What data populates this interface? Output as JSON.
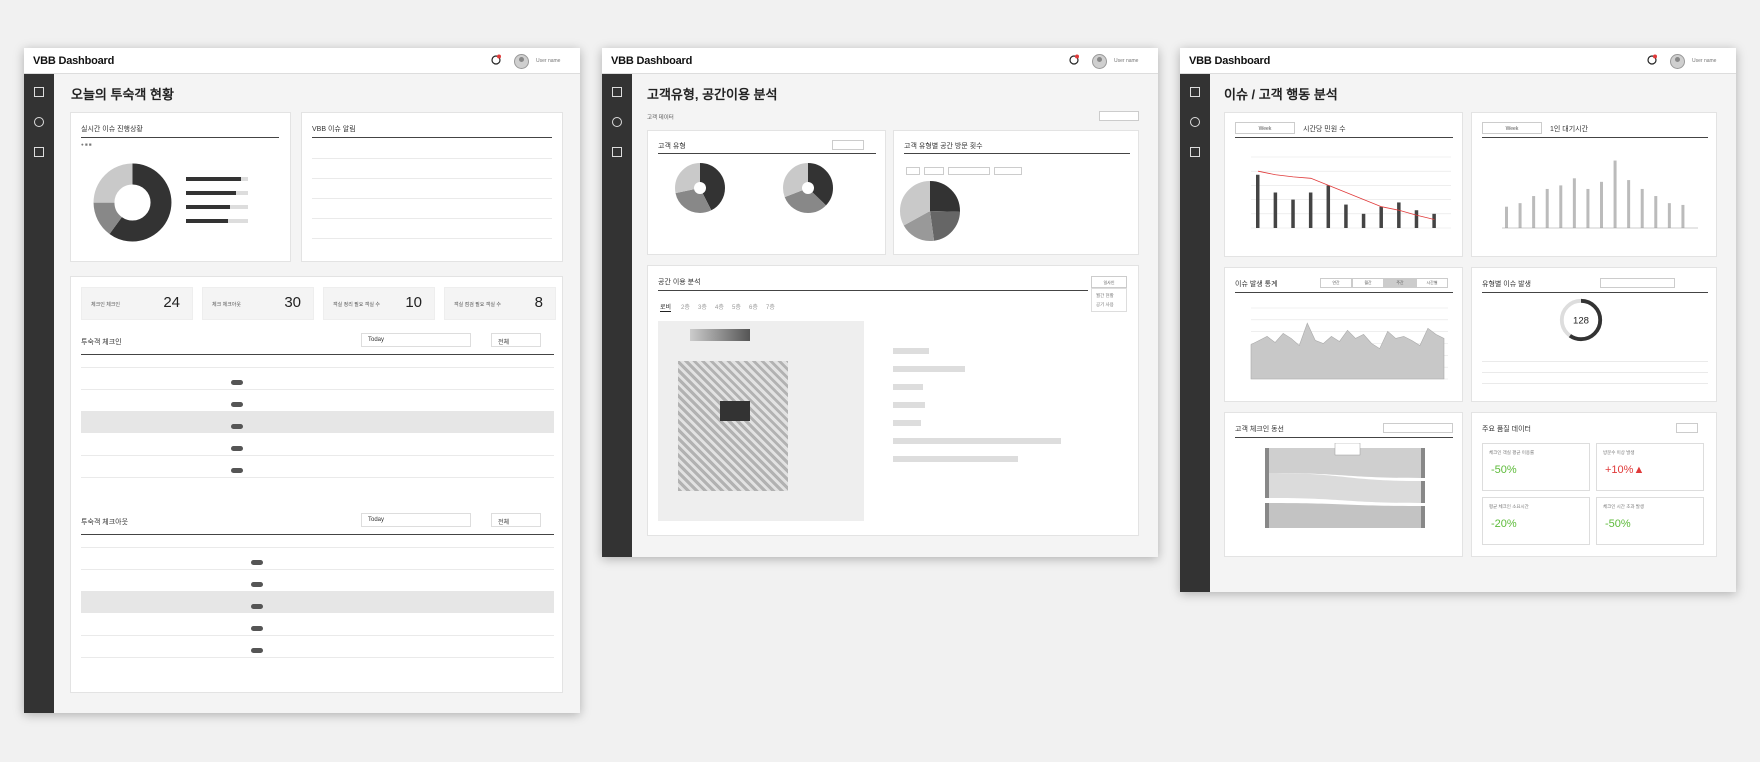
{
  "screen1": {
    "brand": "VBB Dashboard",
    "user": "User name",
    "title": "오늘의 투숙객 현황",
    "card_live": {
      "title": "실시간 이슈 진행상황"
    },
    "card_issue": {
      "title": "VBB 이슈 알림"
    },
    "kpis": [
      {
        "label": "체크인 체크인",
        "value": "24"
      },
      {
        "label": "체크 체크아웃",
        "value": "30"
      },
      {
        "label": "객실 정리 필요 객실 수",
        "value": "10"
      },
      {
        "label": "객실 점검 필요 객실 수",
        "value": "8"
      }
    ],
    "checkin": {
      "title": "투숙객 체크인",
      "filter": "Today",
      "filter2": "전체"
    },
    "checkout": {
      "title": "투숙객 체크아웃",
      "filter": "Today",
      "filter2": "전체"
    }
  },
  "screen2": {
    "brand": "VBB Dashboard",
    "user": "User name",
    "title": "고객유형, 공간이용 분석",
    "subtitle": "고객 데이터",
    "card_type": {
      "title": "고객 유형"
    },
    "card_visit": {
      "title": "고객 유형별 공간 방문 횟수"
    },
    "space": {
      "title": "공간 이용 분석",
      "dropdown": "일사인",
      "menu": [
        "월간 현황",
        "공기 사용"
      ],
      "tabs": [
        "로비",
        "2층",
        "3층",
        "4층",
        "5층",
        "6층",
        "7층"
      ]
    }
  },
  "screen3": {
    "brand": "VBB Dashboard",
    "user": "User name",
    "title": "이슈 / 고객 행동 분석",
    "hourly": {
      "title": "시간당 민원 수",
      "select": "Week"
    },
    "waiting": {
      "title": "1인 대기시간",
      "select": "Week"
    },
    "issue_stats": {
      "title": "이슈 발생 통계",
      "tabs": [
        "연간",
        "월간",
        "주간",
        "시간별"
      ]
    },
    "type_issue": {
      "title": "유형별 이슈 발생",
      "center_value": "128"
    },
    "flow": {
      "title": "고객 체크인 동선"
    },
    "metrics": {
      "title": "주요 품질 데이터",
      "items": [
        {
          "label": "체크인 객실 평균 이용률",
          "value": "-50%",
          "color": "#5dbb3a"
        },
        {
          "label": "방문수 이상 발생",
          "value": "+10%▲",
          "color": "#e03a3a"
        },
        {
          "label": "평균 체크인 소요시간",
          "value": "-20%",
          "color": "#5dbb3a"
        },
        {
          "label": "체크인 시간 초과 발생",
          "value": "-50%",
          "color": "#5dbb3a"
        }
      ]
    }
  },
  "chart_data": [
    {
      "type": "bar",
      "title": "시간당 민원 수",
      "series": [
        {
          "values": [
            7.5,
            5,
            4,
            5,
            6,
            3.3,
            2,
            3,
            3.6,
            2.5,
            2
          ]
        },
        {
          "values": [
            8,
            7.5,
            7.2,
            7,
            6,
            5,
            4,
            3,
            2.5,
            1.8,
            1.2
          ]
        }
      ],
      "ylim": [
        0,
        10
      ]
    },
    {
      "type": "bar",
      "title": "1인 대기시간",
      "values": [
        12,
        14,
        18,
        22,
        24,
        28,
        22,
        26,
        38,
        27,
        22,
        18,
        14,
        13
      ],
      "ylim": [
        0,
        40
      ]
    },
    {
      "type": "area",
      "title": "이슈 발생 통계",
      "values": [
        34,
        38,
        42,
        36,
        45,
        40,
        33,
        55,
        38,
        35,
        42,
        37,
        48,
        40,
        44,
        35,
        30,
        47,
        40,
        42,
        38,
        33,
        50,
        44,
        40
      ],
      "ylim": [
        0,
        70
      ]
    },
    {
      "type": "pie",
      "title": "실시간 이슈 진행상황",
      "values": [
        60,
        15,
        25
      ]
    }
  ]
}
